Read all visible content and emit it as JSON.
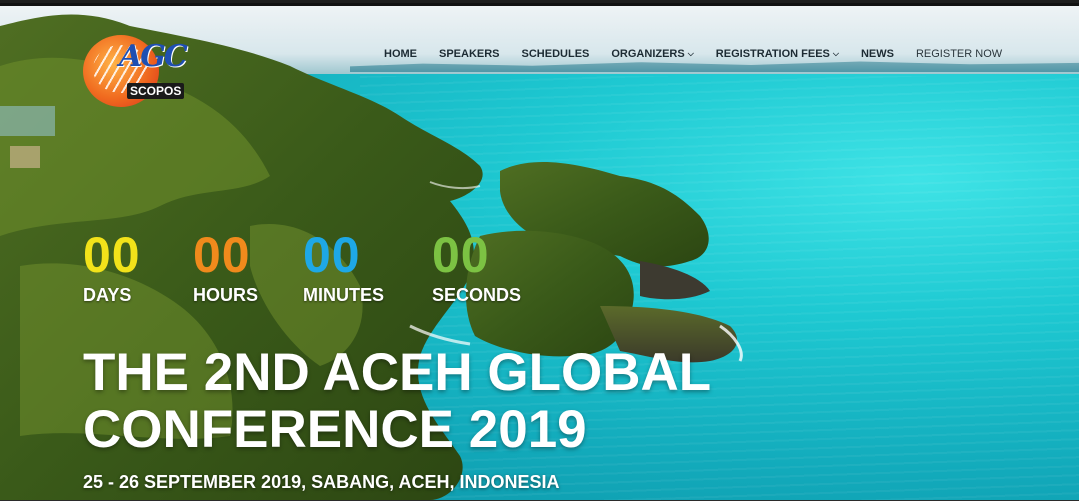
{
  "logo": {
    "mark": "AGC",
    "name": "SCOPOS"
  },
  "nav": {
    "home": "HOME",
    "speakers": "SPEAKERS",
    "schedules": "SCHEDULES",
    "organizers": "ORGANIZERS",
    "registration_fees": "REGISTRATION FEES",
    "news": "NEWS",
    "register_now": "REGISTER NOW"
  },
  "countdown": {
    "days": {
      "value": "00",
      "label": "DAYS",
      "color": "#f2e21a"
    },
    "hours": {
      "value": "00",
      "label": "HOURS",
      "color": "#f08a1c"
    },
    "minutes": {
      "value": "00",
      "label": "MINUTES",
      "color": "#1ea8e6"
    },
    "seconds": {
      "value": "00",
      "label": "SECONDS",
      "color": "#7cc243"
    }
  },
  "hero": {
    "title_line1": "THE 2ND ACEH GLOBAL",
    "title_line2": "CONFERENCE 2019",
    "subtitle": "25 - 26 SEPTEMBER 2019, SABANG, ACEH, INDONESIA"
  }
}
